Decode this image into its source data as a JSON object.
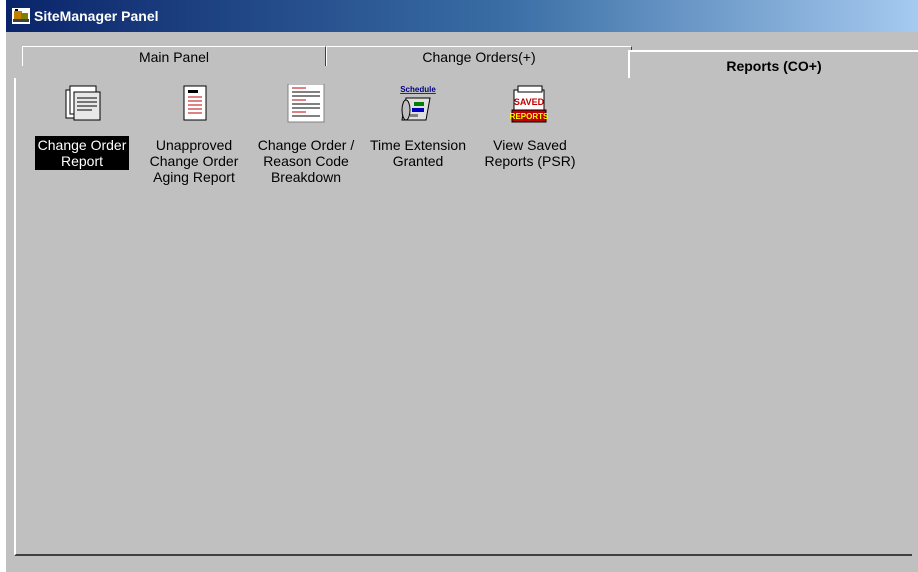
{
  "window": {
    "title": "SiteManager Panel",
    "icon": "sitemanager-app-icon"
  },
  "tabs": [
    {
      "label": "Main Panel",
      "active": false
    },
    {
      "label": "Change Orders(+)",
      "active": false
    },
    {
      "label": "Reports (CO+)",
      "active": true
    }
  ],
  "items": [
    {
      "label": "Change Order\nReport",
      "icon": "document-stack-icon",
      "selected": true
    },
    {
      "label": "Unapproved\nChange Order\nAging Report",
      "icon": "report-list-icon",
      "selected": false
    },
    {
      "label": "Change Order /\nReason Code\nBreakdown",
      "icon": "breakdown-sheet-icon",
      "selected": false
    },
    {
      "label": "Time Extension\nGranted",
      "icon": "schedule-scroll-icon",
      "icon_text": "Schedule",
      "selected": false
    },
    {
      "label": "View Saved\nReports (PSR)",
      "icon": "saved-reports-icon",
      "icon_text_top": "SAVED",
      "icon_text_bottom": "REPORTS",
      "selected": false
    }
  ],
  "colors": {
    "face": "#c0c0c0",
    "title_start": "#0a246a",
    "title_end": "#a6caf0",
    "selected_bg": "#000000"
  }
}
